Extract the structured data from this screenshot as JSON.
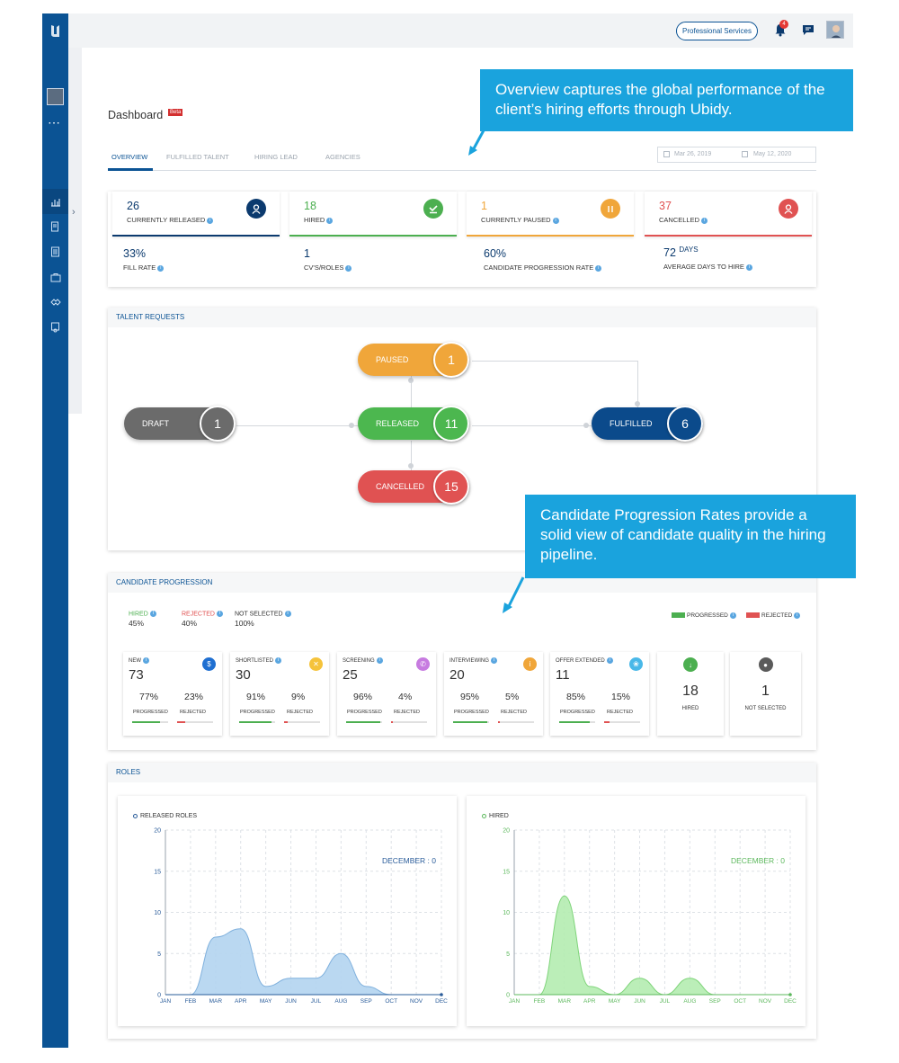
{
  "header": {
    "org_button": "Professional Services",
    "notification_count": "4"
  },
  "sidebar": {
    "dots": "⋯",
    "expand": "›"
  },
  "page": {
    "title": "Dashboard",
    "badge": "Beta"
  },
  "tabs": [
    "OVERVIEW",
    "FULFILLED TALENT",
    "HIRING LEAD",
    "AGENCIES"
  ],
  "date_range": {
    "from": "Mar 26, 2019",
    "to": "May 12, 2020"
  },
  "stats_top": [
    {
      "value": "26",
      "label": "CURRENTLY RELEASED",
      "color": "#0b3a6e",
      "icon": "user-icon"
    },
    {
      "value": "18",
      "label": "HIRED",
      "color": "#4caf50",
      "icon": "check-icon"
    },
    {
      "value": "1",
      "label": "CURRENTLY PAUSED",
      "color": "#f0a63a",
      "icon": "pause-icon"
    },
    {
      "value": "37",
      "label": "CANCELLED",
      "color": "#e05252",
      "icon": "user-cancel-icon"
    }
  ],
  "stats_bottom": [
    {
      "value": "33%",
      "suffix": "",
      "label": "FILL RATE"
    },
    {
      "value": "1",
      "suffix": "",
      "label": "CV'S/ROLES"
    },
    {
      "value": "60%",
      "suffix": "",
      "label": "CANDIDATE PROGRESSION RATE"
    },
    {
      "value": "72",
      "suffix": "DAYS",
      "label": "AVERAGE DAYS TO HIRE"
    }
  ],
  "talent_requests": {
    "title": "TALENT REQUESTS",
    "nodes": [
      {
        "label": "DRAFT",
        "count": "1",
        "color": "#6b6b6b"
      },
      {
        "label": "PAUSED",
        "count": "1",
        "color": "#f0a63a"
      },
      {
        "label": "RELEASED",
        "count": "11",
        "color": "#4cb74f"
      },
      {
        "label": "CANCELLED",
        "count": "15",
        "color": "#e05252"
      },
      {
        "label": "FULFILLED",
        "count": "6",
        "color": "#0b4a8b"
      }
    ]
  },
  "candidate_progression": {
    "title": "CANDIDATE PROGRESSION",
    "summary": [
      {
        "label": "HIRED",
        "value": "45%",
        "color": "#4caf50"
      },
      {
        "label": "REJECTED",
        "value": "40%",
        "color": "#e05252"
      },
      {
        "label": "NOT SELECTED",
        "value": "100%",
        "color": "#333333"
      }
    ],
    "legend": [
      {
        "label": "PROGRESSED",
        "color": "#4caf50"
      },
      {
        "label": "REJECTED",
        "color": "#e05252"
      }
    ],
    "progressed_label": "PROGRESSED",
    "rejected_label": "REJECTED",
    "stages": [
      {
        "label": "NEW",
        "value": "73",
        "progressed": "77%",
        "rejected": "23%",
        "p_frac": 0.77,
        "r_frac": 0.23,
        "icon_color": "#1f6fd1",
        "icon": "dollar-icon",
        "glyph": "$"
      },
      {
        "label": "SHORTLISTED",
        "value": "30",
        "progressed": "91%",
        "rejected": "9%",
        "p_frac": 0.91,
        "r_frac": 0.09,
        "icon_color": "#f5c33b",
        "icon": "star-icon",
        "glyph": "✕"
      },
      {
        "label": "SCREENING",
        "value": "25",
        "progressed": "96%",
        "rejected": "4%",
        "p_frac": 0.96,
        "r_frac": 0.04,
        "icon_color": "#c77be0",
        "icon": "phone-icon",
        "glyph": "✆"
      },
      {
        "label": "INTERVIEWING",
        "value": "20",
        "progressed": "95%",
        "rejected": "5%",
        "p_frac": 0.95,
        "r_frac": 0.05,
        "icon_color": "#f0a63a",
        "icon": "info-icon",
        "glyph": "i"
      },
      {
        "label": "OFFER EXTENDED",
        "value": "11",
        "progressed": "85%",
        "rejected": "15%",
        "p_frac": 0.85,
        "r_frac": 0.15,
        "icon_color": "#49b8e8",
        "icon": "handshake-icon",
        "glyph": "❀"
      }
    ],
    "finals": [
      {
        "label": "HIRED",
        "value": "18",
        "icon_color": "#4caf50",
        "icon": "download-check-icon",
        "glyph": "↓"
      },
      {
        "label": "NOT SELECTED",
        "value": "1",
        "icon_color": "#5a5a5a",
        "icon": "user-icon",
        "glyph": "●"
      }
    ]
  },
  "roles": {
    "title": "ROLES"
  },
  "chart_data": [
    {
      "type": "area",
      "title": "RELEASED ROLES",
      "annotation": "DECEMBER : 0",
      "color": "#2a5c9a",
      "fill": "#b3d4ef",
      "stroke": "#7fb0dd",
      "x": [
        "JAN",
        "FEB",
        "MAR",
        "APR",
        "MAY",
        "JUN",
        "JUL",
        "AUG",
        "SEP",
        "OCT",
        "NOV",
        "DEC"
      ],
      "y": [
        0,
        0,
        7,
        8,
        1,
        2,
        2,
        5,
        1,
        0,
        0,
        0
      ],
      "ylim": [
        0,
        20
      ],
      "yticks": [
        0,
        5,
        10,
        15,
        20
      ],
      "grid": true
    },
    {
      "type": "area",
      "title": "HIRED",
      "annotation": "DECEMBER : 0",
      "color": "#5cb85c",
      "fill": "#b4ecb0",
      "stroke": "#7fd47a",
      "x": [
        "JAN",
        "FEB",
        "MAR",
        "APR",
        "MAY",
        "JUN",
        "JUL",
        "AUG",
        "SEP",
        "OCT",
        "NOV",
        "DEC"
      ],
      "y": [
        0,
        0,
        12,
        1,
        0,
        2,
        0,
        2,
        0,
        0,
        0,
        0
      ],
      "ylim": [
        0,
        20
      ],
      "yticks": [
        0,
        5,
        10,
        15,
        20
      ],
      "grid": true
    }
  ],
  "callouts": {
    "overview": "Overview captures the global performance of the client’s hiring efforts through Ubidy.",
    "progression": "Candidate Progression Rates provide a solid view of candidate quality in the hiring pipeline."
  }
}
